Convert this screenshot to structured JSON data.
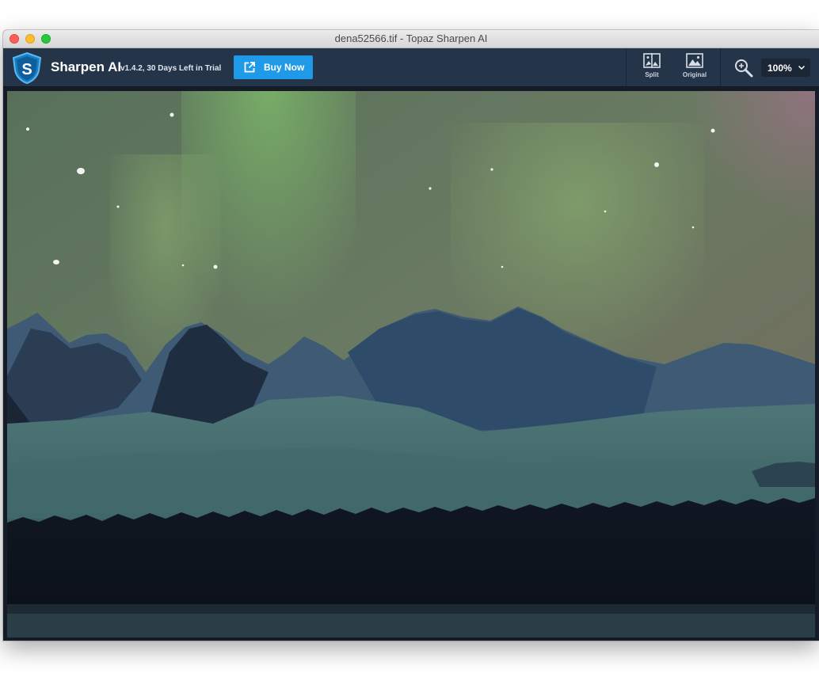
{
  "window": {
    "title": "dena52566.tif - Topaz Sharpen AI"
  },
  "toolbar": {
    "app_name": "Sharpen AI",
    "version_info": "v1.4.2, 30 Days Left in Trial",
    "buy_now_label": "Buy Now",
    "split_label": "Split",
    "original_label": "Original",
    "zoom_value": "100%"
  },
  "colors": {
    "toolbar_bg": "#253549",
    "buy_now_bg": "#1f9ae8",
    "canvas_bg": "#151c28"
  },
  "icons": {
    "logo": "topaz-logo-icon",
    "buy_now": "external-link-icon",
    "split": "split-view-icon",
    "original": "original-image-icon",
    "zoom": "zoom-magnifier-icon",
    "zoom_dropdown": "chevron-down-icon"
  },
  "canvas": {
    "image_subject": "photo"
  }
}
